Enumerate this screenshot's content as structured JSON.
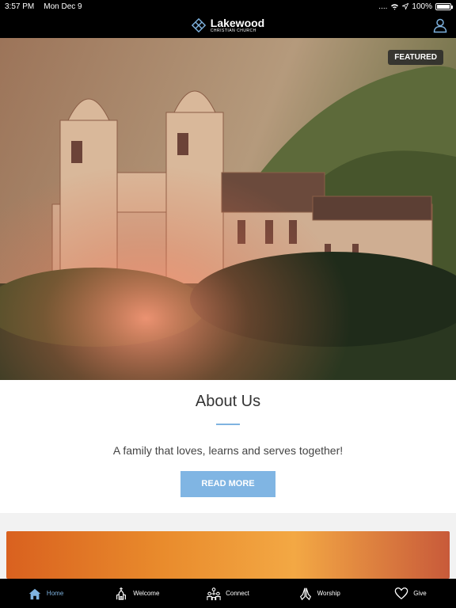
{
  "status": {
    "time": "3:57 PM",
    "date": "Mon Dec 9",
    "signal": "....",
    "battery": "100%",
    "battery_level": 1.0
  },
  "app": {
    "logo_title": "Lakewood",
    "logo_subtitle": "CHRISTIAN CHURCH"
  },
  "hero": {
    "badge": "FEATURED"
  },
  "about": {
    "title": "About Us",
    "text": "A family that loves, learns and serves together!",
    "button": "READ MORE"
  },
  "tabs": [
    {
      "label": "Home",
      "icon": "home-icon",
      "active": true
    },
    {
      "label": "Welcome",
      "icon": "church-icon",
      "active": false
    },
    {
      "label": "Connect",
      "icon": "people-icon",
      "active": false
    },
    {
      "label": "Worship",
      "icon": "praying-hands-icon",
      "active": false
    },
    {
      "label": "Give",
      "icon": "heart-icon",
      "active": false
    }
  ],
  "colors": {
    "accent": "#80b5e3",
    "bar": "#000000"
  }
}
